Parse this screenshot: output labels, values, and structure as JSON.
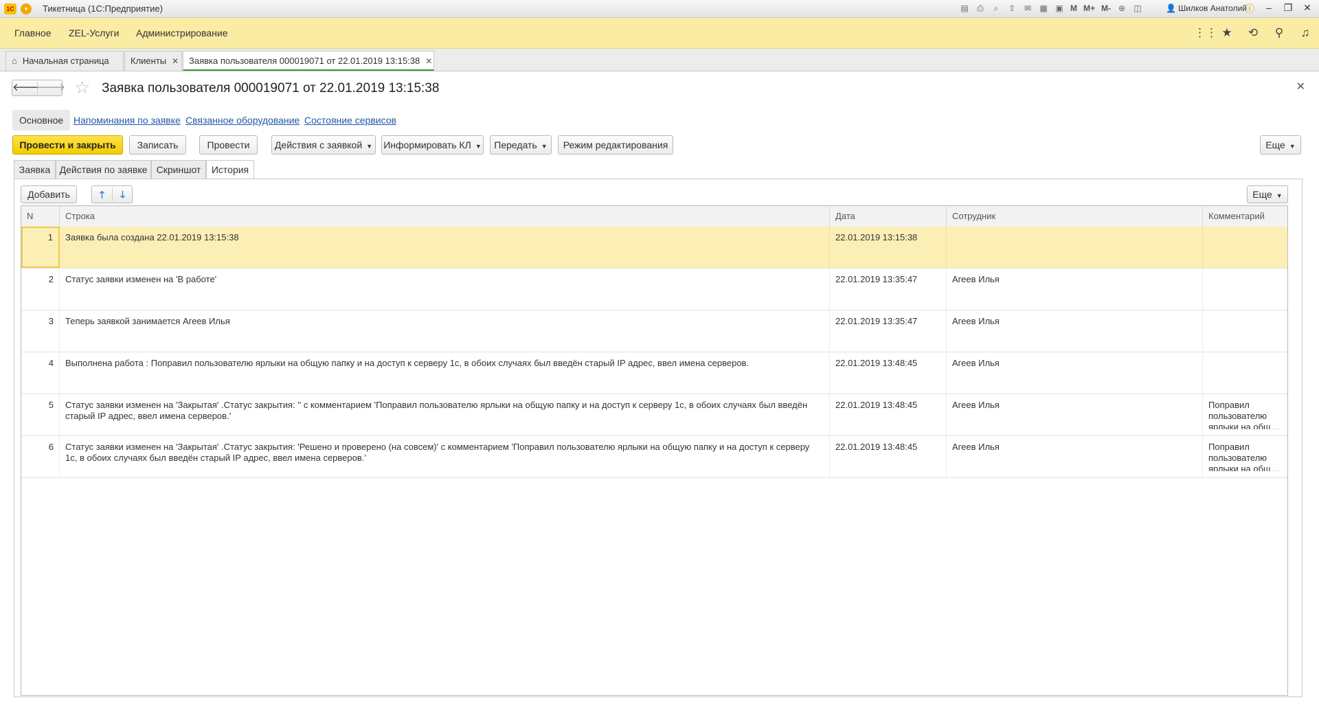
{
  "window": {
    "logo": "1C",
    "title": "Тикетница (1С:Предприятие)",
    "m_buttons": [
      "M",
      "M+",
      "M-"
    ],
    "user": "Шилков Анатолий",
    "icons": [
      "save-icon",
      "print-icon",
      "preview-icon",
      "upload-icon",
      "mail-icon",
      "table-icon",
      "calendar-icon",
      "zoom-icon",
      "panel-icon",
      "info-icon",
      "minimize-icon",
      "restore-icon",
      "close-icon"
    ]
  },
  "menu": {
    "items": [
      "Главное",
      "ZEL-Услуги",
      "Администрирование"
    ],
    "icons": [
      "apps-grid-icon",
      "favorites-star-icon",
      "history-icon",
      "search-icon",
      "notifications-bell-icon"
    ]
  },
  "open_tabs": [
    {
      "label": "Начальная страница"
    },
    {
      "label": "Клиенты"
    },
    {
      "label": "Заявка пользователя 000019071 от 22.01.2019 13:15:38"
    }
  ],
  "document": {
    "title": "Заявка пользователя 000019071 от 22.01.2019 13:15:38"
  },
  "nav_links": [
    "Основное",
    "Напоминания по заявке",
    "Связанное оборудование",
    "Состояние сервисов"
  ],
  "toolbar": {
    "post_close": "Провести и закрыть",
    "save": "Записать",
    "post": "Провести",
    "actions": "Действия с заявкой",
    "inform": "Информировать КЛ",
    "transfer": "Передать",
    "edit_mode": "Режим редактирования",
    "more": "Еще"
  },
  "form_tabs": [
    "Заявка",
    "Действия по заявке",
    "Скриншот",
    "История"
  ],
  "history": {
    "add_button": "Добавить",
    "more": "Еще",
    "columns": {
      "n": "N",
      "line": "Строка",
      "date": "Дата",
      "employee": "Сотрудник",
      "comment": "Комментарий"
    },
    "rows": [
      {
        "n": "1",
        "line": "Заявка была создана 22.01.2019 13:15:38",
        "date": "22.01.2019 13:15:38",
        "employee": "",
        "comment": ""
      },
      {
        "n": "2",
        "line": "Статус заявки изменен на 'В работе'",
        "date": "22.01.2019 13:35:47",
        "employee": "Агеев Илья",
        "comment": ""
      },
      {
        "n": "3",
        "line": "Теперь заявкой занимается Агеев Илья",
        "date": "22.01.2019 13:35:47",
        "employee": "Агеев Илья",
        "comment": ""
      },
      {
        "n": "4",
        "line": "Выполнена работа : Поправил пользователю ярлыки на общую папку и на доступ к серверу 1с, в обоих случаях был введён старый IP адрес, ввел имена серверов.",
        "date": "22.01.2019 13:48:45",
        "employee": "Агеев Илья",
        "comment": ""
      },
      {
        "n": "5",
        "line": "Статус заявки изменен на 'Закрытая' .Статус закрытия: '' с комментарием 'Поправил пользователю ярлыки на общую папку и на доступ к серверу 1с, в обоих случаях был введён старый IP адрес, ввел имена серверов.'",
        "date": "22.01.2019 13:48:45",
        "employee": "Агеев Илья",
        "comment": "Поправил пользователю ярлыки на общую папку и н..."
      },
      {
        "n": "6",
        "line": "Статус заявки изменен на 'Закрытая' .Статус закрытия: 'Решено и проверено (на совсем)' с комментарием 'Поправил пользователю ярлыки на общую папку и на доступ к серверу 1с, в обоих случаях был введён старый IP адрес, ввел имена серверов.'",
        "date": "22.01.2019 13:48:45",
        "employee": "Агеев Илья",
        "comment": "Поправил пользователю ярлыки на общую папку и н..."
      }
    ]
  }
}
